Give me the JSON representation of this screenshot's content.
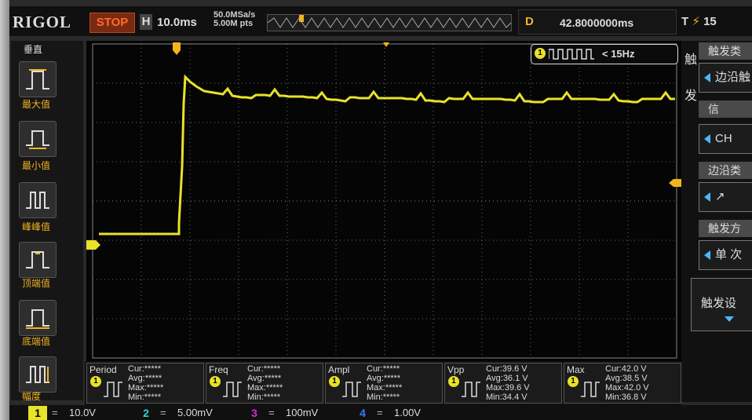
{
  "brand": "RIGOL",
  "run_state": "STOP",
  "horizontal": {
    "label": "H",
    "timebase": "10.0ms",
    "sample_rate": "50.0MSa/s",
    "memory_depth": "5.00M pts"
  },
  "delay": {
    "label": "D",
    "value": "42.8000000ms"
  },
  "trigger_status": {
    "label": "T",
    "icon": "trigger-edge-icon",
    "value": "15"
  },
  "left_menu": {
    "header": "垂直",
    "items": [
      {
        "label": "最大值",
        "icon": "pulse-max-icon"
      },
      {
        "label": "最小值",
        "icon": "pulse-min-icon"
      },
      {
        "label": "峰峰值",
        "icon": "pulse-pkpk-icon"
      },
      {
        "label": "顶端值",
        "icon": "pulse-top-icon"
      },
      {
        "label": "底端值",
        "icon": "pulse-base-icon"
      },
      {
        "label": "幅度",
        "icon": "pulse-amp-icon"
      }
    ]
  },
  "frequency_readout": "< 15Hz",
  "right_menu": {
    "side_label_1": "触",
    "side_label_2": "发",
    "items": [
      {
        "title": "触发类",
        "value": "边沿触"
      },
      {
        "title": "信",
        "value": "CH"
      },
      {
        "title": "边沿类",
        "value": "↗"
      },
      {
        "title": "触发方",
        "value": "单 次"
      },
      {
        "title": "触发设",
        "value": ""
      }
    ]
  },
  "measurements": [
    {
      "name": "Period",
      "channel": "1",
      "cur": "*****",
      "avg": "*****",
      "max": "*****",
      "min": "*****"
    },
    {
      "name": "Freq",
      "channel": "1",
      "cur": "*****",
      "avg": "*****",
      "max": "*****",
      "min": "*****"
    },
    {
      "name": "Ampl",
      "channel": "1",
      "cur": "*****",
      "avg": "*****",
      "max": "*****",
      "min": "*****"
    },
    {
      "name": "Vpp",
      "channel": "1",
      "cur": "39.6 V",
      "avg": "36.1 V",
      "max": "39.6 V",
      "min": "34.4 V"
    },
    {
      "name": "Max",
      "channel": "1",
      "cur": "42.0 V",
      "avg": "38.5 V",
      "max": "42.0 V",
      "min": "36.8 V"
    }
  ],
  "measurement_labels": {
    "cur": "Cur:",
    "avg": "Avg:",
    "max": "Max:",
    "min": "Min:"
  },
  "channels": [
    {
      "num": "1",
      "scale": "10.0V",
      "color": "#e8e228"
    },
    {
      "num": "2",
      "scale": "5.00mV",
      "color": "#2ad4e0"
    },
    {
      "num": "3",
      "scale": "100mV",
      "color": "#d22ad6"
    },
    {
      "num": "4",
      "scale": "1.00V",
      "color": "#3a7bff"
    }
  ],
  "colors": {
    "ch1": "#e8e228",
    "accent": "#f2b31e",
    "stop": "#ff6a2a",
    "grid": "#6a6a6a"
  },
  "channel_coupling_icon": "coupling-icon"
}
